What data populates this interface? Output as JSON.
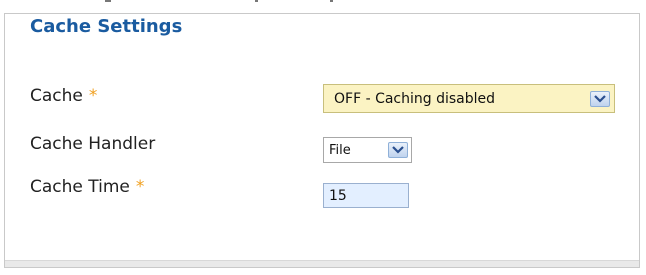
{
  "section": {
    "title": "Cache Settings"
  },
  "fields": {
    "cache": {
      "label": "Cache",
      "required_marker": "*",
      "selected": "OFF - Caching disabled"
    },
    "cache_handler": {
      "label": "Cache Handler",
      "selected": "File"
    },
    "cache_time": {
      "label": "Cache Time",
      "required_marker": "*",
      "value": "15"
    }
  },
  "colors": {
    "legend_title": "#1a5ba0",
    "required_star": "#f0a020",
    "cache_select_bg": "#fbf3c3",
    "cache_time_bg": "#e3efff"
  },
  "icons": {
    "dropdown": "chevron-down-icon"
  }
}
